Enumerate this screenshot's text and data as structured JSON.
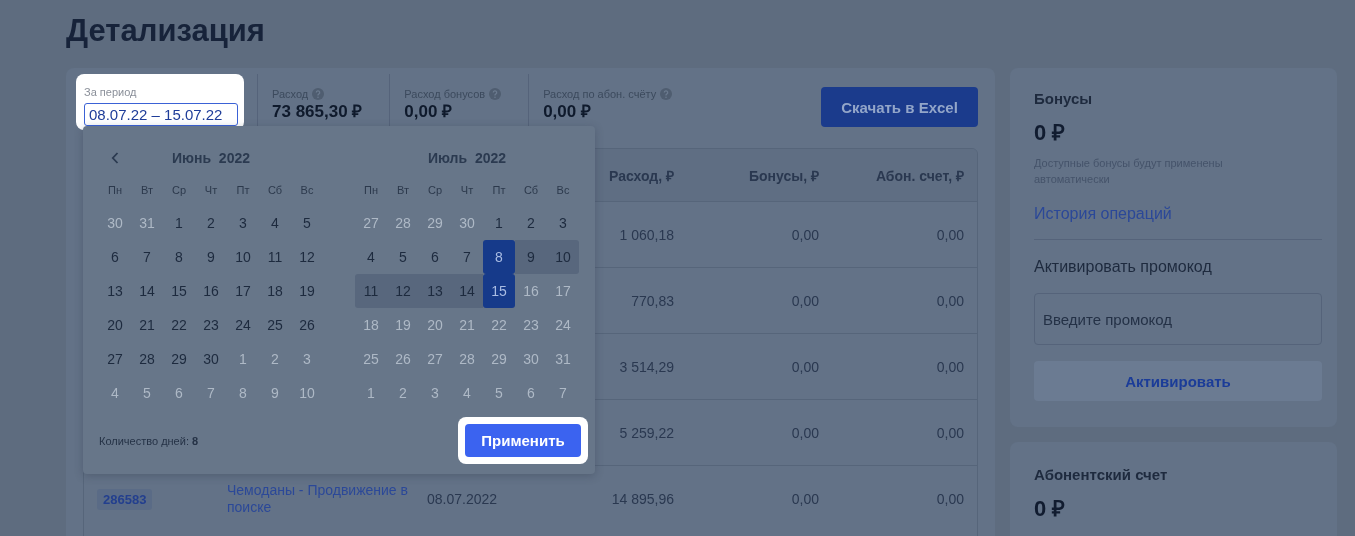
{
  "page_title": "Детализация",
  "period": {
    "label": "За период",
    "value": "08.07.22 – 15.07.22",
    "highlighted": true
  },
  "stats": [
    {
      "label": "Расход",
      "value": "73 865,30 ₽",
      "help": true
    },
    {
      "label": "Расход бонусов",
      "value": "0,00 ₽",
      "help": true
    },
    {
      "label": "Расход по абон. счёту",
      "value": "0,00 ₽",
      "help": true
    }
  ],
  "download_button": "Скачать в Excel",
  "table": {
    "columns": [
      "Расход, ₽",
      "Бонусы, ₽",
      "Абон. счет, ₽"
    ],
    "rows": [
      {
        "expense": "1 060,18",
        "bonuses": "0,00",
        "account": "0,00"
      },
      {
        "expense": "770,83",
        "bonuses": "0,00",
        "account": "0,00"
      },
      {
        "expense": "3 514,29",
        "bonuses": "0,00",
        "account": "0,00"
      },
      {
        "expense": "5 259,22",
        "bonuses": "0,00",
        "account": "0,00"
      },
      {
        "id": "286583",
        "name": "Чемоданы - Продвижение в поиске",
        "date": "08.07.2022",
        "expense": "14 895,96",
        "bonuses": "0,00",
        "account": "0,00"
      }
    ]
  },
  "calendar": {
    "months": [
      {
        "title": "Июнь  2022",
        "prev_arrow": true,
        "weekdays": [
          "Пн",
          "Вт",
          "Ср",
          "Чт",
          "Пт",
          "Сб",
          "Вс"
        ],
        "weeks": [
          [
            {
              "day": "30",
              "outside": true,
              "selected": false,
              "in_range": false
            },
            {
              "day": "31",
              "outside": true,
              "selected": false,
              "in_range": false
            },
            {
              "day": "1",
              "outside": false,
              "selected": false,
              "in_range": false
            },
            {
              "day": "2",
              "outside": false,
              "selected": false,
              "in_range": false
            },
            {
              "day": "3",
              "outside": false,
              "selected": false,
              "in_range": false
            },
            {
              "day": "4",
              "outside": false,
              "selected": false,
              "in_range": false
            },
            {
              "day": "5",
              "outside": false,
              "selected": false,
              "in_range": false
            }
          ],
          [
            {
              "day": "6",
              "outside": false,
              "selected": false,
              "in_range": false
            },
            {
              "day": "7",
              "outside": false,
              "selected": false,
              "in_range": false
            },
            {
              "day": "8",
              "outside": false,
              "selected": false,
              "in_range": false
            },
            {
              "day": "9",
              "outside": false,
              "selected": false,
              "in_range": false
            },
            {
              "day": "10",
              "outside": false,
              "selected": false,
              "in_range": false
            },
            {
              "day": "11",
              "outside": false,
              "selected": false,
              "in_range": false
            },
            {
              "day": "12",
              "outside": false,
              "selected": false,
              "in_range": false
            }
          ],
          [
            {
              "day": "13",
              "outside": false,
              "selected": false,
              "in_range": false
            },
            {
              "day": "14",
              "outside": false,
              "selected": false,
              "in_range": false
            },
            {
              "day": "15",
              "outside": false,
              "selected": false,
              "in_range": false
            },
            {
              "day": "16",
              "outside": false,
              "selected": false,
              "in_range": false
            },
            {
              "day": "17",
              "outside": false,
              "selected": false,
              "in_range": false
            },
            {
              "day": "18",
              "outside": false,
              "selected": false,
              "in_range": false
            },
            {
              "day": "19",
              "outside": false,
              "selected": false,
              "in_range": false
            }
          ],
          [
            {
              "day": "20",
              "outside": false,
              "selected": false,
              "in_range": false
            },
            {
              "day": "21",
              "outside": false,
              "selected": false,
              "in_range": false
            },
            {
              "day": "22",
              "outside": false,
              "selected": false,
              "in_range": false
            },
            {
              "day": "23",
              "outside": false,
              "selected": false,
              "in_range": false
            },
            {
              "day": "24",
              "outside": false,
              "selected": false,
              "in_range": false
            },
            {
              "day": "25",
              "outside": false,
              "selected": false,
              "in_range": false
            },
            {
              "day": "26",
              "outside": false,
              "selected": false,
              "in_range": false
            }
          ],
          [
            {
              "day": "27",
              "outside": false,
              "selected": false,
              "in_range": false
            },
            {
              "day": "28",
              "outside": false,
              "selected": false,
              "in_range": false
            },
            {
              "day": "29",
              "outside": false,
              "selected": false,
              "in_range": false
            },
            {
              "day": "30",
              "outside": false,
              "selected": false,
              "in_range": false
            },
            {
              "day": "1",
              "outside": true,
              "selected": false,
              "in_range": false
            },
            {
              "day": "2",
              "outside": true,
              "selected": false,
              "in_range": false
            },
            {
              "day": "3",
              "outside": true,
              "selected": false,
              "in_range": false
            }
          ],
          [
            {
              "day": "4",
              "outside": true,
              "selected": false,
              "in_range": false
            },
            {
              "day": "5",
              "outside": true,
              "selected": false,
              "in_range": false
            },
            {
              "day": "6",
              "outside": true,
              "selected": false,
              "in_range": false
            },
            {
              "day": "7",
              "outside": true,
              "selected": false,
              "in_range": false
            },
            {
              "day": "8",
              "outside": true,
              "selected": false,
              "in_range": false
            },
            {
              "day": "9",
              "outside": true,
              "selected": false,
              "in_range": false
            },
            {
              "day": "10",
              "outside": true,
              "selected": false,
              "in_range": false
            }
          ]
        ]
      },
      {
        "title": "Июль  2022",
        "prev_arrow": false,
        "weekdays": [
          "Пн",
          "Вт",
          "Ср",
          "Чт",
          "Пт",
          "Сб",
          "Вс"
        ],
        "weeks": [
          [
            {
              "day": "27",
              "outside": true,
              "selected": false,
              "in_range": false
            },
            {
              "day": "28",
              "outside": true,
              "selected": false,
              "in_range": false
            },
            {
              "day": "29",
              "outside": true,
              "selected": false,
              "in_range": false
            },
            {
              "day": "30",
              "outside": true,
              "selected": false,
              "in_range": false
            },
            {
              "day": "1",
              "outside": false,
              "selected": false,
              "in_range": false
            },
            {
              "day": "2",
              "outside": false,
              "selected": false,
              "in_range": false
            },
            {
              "day": "3",
              "outside": false,
              "selected": false,
              "in_range": false
            }
          ],
          [
            {
              "day": "4",
              "outside": false,
              "selected": false,
              "in_range": false
            },
            {
              "day": "5",
              "outside": false,
              "selected": false,
              "in_range": false
            },
            {
              "day": "6",
              "outside": false,
              "selected": false,
              "in_range": false
            },
            {
              "day": "7",
              "outside": false,
              "selected": false,
              "in_range": false
            },
            {
              "day": "8",
              "outside": false,
              "selected": true,
              "in_range": true
            },
            {
              "day": "9",
              "outside": false,
              "selected": false,
              "in_range": true
            },
            {
              "day": "10",
              "outside": false,
              "selected": false,
              "in_range": true
            }
          ],
          [
            {
              "day": "11",
              "outside": false,
              "selected": false,
              "in_range": true
            },
            {
              "day": "12",
              "outside": false,
              "selected": false,
              "in_range": true
            },
            {
              "day": "13",
              "outside": false,
              "selected": false,
              "in_range": true
            },
            {
              "day": "14",
              "outside": false,
              "selected": false,
              "in_range": true
            },
            {
              "day": "15",
              "outside": false,
              "selected": true,
              "in_range": true
            },
            {
              "day": "16",
              "outside": true,
              "selected": false,
              "in_range": false
            },
            {
              "day": "17",
              "outside": true,
              "selected": false,
              "in_range": false
            }
          ],
          [
            {
              "day": "18",
              "outside": true,
              "selected": false,
              "in_range": false
            },
            {
              "day": "19",
              "outside": true,
              "selected": false,
              "in_range": false
            },
            {
              "day": "20",
              "outside": true,
              "selected": false,
              "in_range": false
            },
            {
              "day": "21",
              "outside": true,
              "selected": false,
              "in_range": false
            },
            {
              "day": "22",
              "outside": true,
              "selected": false,
              "in_range": false
            },
            {
              "day": "23",
              "outside": true,
              "selected": false,
              "in_range": false
            },
            {
              "day": "24",
              "outside": true,
              "selected": false,
              "in_range": false
            }
          ],
          [
            {
              "day": "25",
              "outside": true,
              "selected": false,
              "in_range": false
            },
            {
              "day": "26",
              "outside": true,
              "selected": false,
              "in_range": false
            },
            {
              "day": "27",
              "outside": true,
              "selected": false,
              "in_range": false
            },
            {
              "day": "28",
              "outside": true,
              "selected": false,
              "in_range": false
            },
            {
              "day": "29",
              "outside": true,
              "selected": false,
              "in_range": false
            },
            {
              "day": "30",
              "outside": true,
              "selected": false,
              "in_range": false
            },
            {
              "day": "31",
              "outside": true,
              "selected": false,
              "in_range": false
            }
          ],
          [
            {
              "day": "1",
              "outside": true,
              "selected": false,
              "in_range": false
            },
            {
              "day": "2",
              "outside": true,
              "selected": false,
              "in_range": false
            },
            {
              "day": "3",
              "outside": true,
              "selected": false,
              "in_range": false
            },
            {
              "day": "4",
              "outside": true,
              "selected": false,
              "in_range": false
            },
            {
              "day": "5",
              "outside": true,
              "selected": false,
              "in_range": false
            },
            {
              "day": "6",
              "outside": true,
              "selected": false,
              "in_range": false
            },
            {
              "day": "7",
              "outside": true,
              "selected": false,
              "in_range": false
            }
          ]
        ]
      }
    ],
    "days_count": "Количество дней: **8**",
    "apply_button": {
      "label": "Применить",
      "highlighted": true
    }
  },
  "bonuses_card": {
    "title": "Бонусы",
    "amount": "0 ₽",
    "note": "Доступные бонусы будут применены автоматически",
    "history_link": "История операций",
    "promo_title": "Активировать промокод",
    "promo_placeholder": "Введите промокод",
    "activate_button": {
      "label": "Активировать",
      "disabled": true
    }
  },
  "account_card": {
    "title": "Абонентский счет",
    "amount": "0 ₽"
  }
}
